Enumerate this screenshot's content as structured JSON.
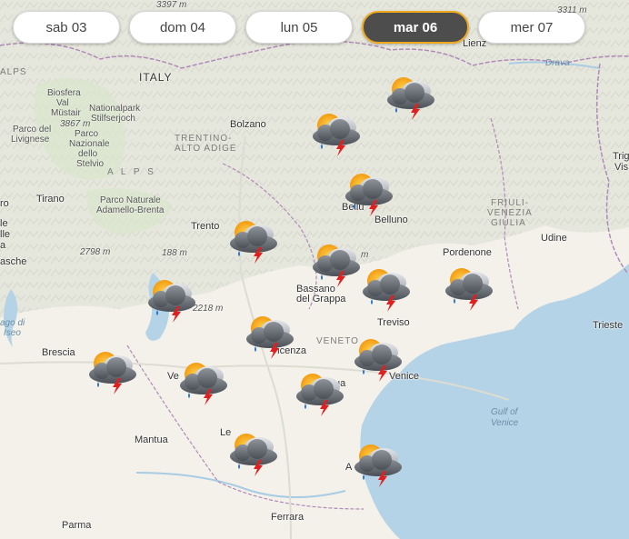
{
  "tabs": [
    {
      "label": "sab 03",
      "active": false
    },
    {
      "label": "dom 04",
      "active": false
    },
    {
      "label": "lun 05",
      "active": false
    },
    {
      "label": "mar 06",
      "active": true
    },
    {
      "label": "mer 07",
      "active": false
    }
  ],
  "labels": {
    "italy": "ITALY",
    "bolzano": "Bolzano",
    "trento": "Trento",
    "tirano": "Tirano",
    "belluno": "Belluno",
    "bassano": "Bassano",
    "del_grappa": "del Grappa",
    "pordenone": "Pordenone",
    "udine": "Udine",
    "treviso": "Treviso",
    "venice": "Venice",
    "vicenza": "Vicenza",
    "brescia": "Brescia",
    "mantua": "Mantua",
    "parma": "Parma",
    "ferrara": "Ferrara",
    "trieste": "Trieste",
    "lienz": "Lienz",
    "drava": "Drava",
    "trentino_1": "TRENTINO-",
    "trentino_2": "ALTO ADIGE",
    "veneto": "VENETO",
    "friuli_1": "FRIULI-",
    "friuli_2": "VENEZIA",
    "friuli_3": "GIULIA",
    "alps": "A L P S",
    "park_biosfera_1": "Biosfera",
    "park_biosfera_2": "Val",
    "park_biosfera_3": "Müstair",
    "park_stelvio_1": "Nationalpark",
    "park_stelvio_2": "Stilfserjoch",
    "park_stelvio_3": "Parco",
    "park_stelvio_4": "Nazionale",
    "park_stelvio_5": "dello",
    "park_stelvio_6": "Stelvio",
    "park_livigno_1": "Parco del",
    "park_livigno_2": "Livignese",
    "park_adamello_1": "Parco Naturale",
    "park_adamello_2": "Adamello-Brenta",
    "peak_3397": "3397 m",
    "peak_3311": "3311 m",
    "peak_3867": "3867 m",
    "peak_2798": "2798 m",
    "peak_188": "188 m",
    "peak_2218": "2218 m",
    "peak_m": "m",
    "alps_short": "ALPS",
    "lago_1": "ago di",
    "lago_2": "Iseo",
    "gulf_1": "Gulf of",
    "gulf_2": "Venice",
    "tri_1": "Trig",
    "tri_2": "Vis",
    "le_1": "le",
    "le_2": "lle",
    "le_3": "a",
    "le_4": "asche",
    "le_5": "ro",
    "frag_ve": "Ve",
    "frag_le": "Le",
    "frag_a": "A",
    "frag_ua": "ua",
    "frag_bellu": "Bellu"
  },
  "forecast_icon": "sun-cloud-thunderstorm-rain-icon",
  "colors": {
    "tab_active_bg": "#4d4d4d",
    "tab_active_border": "#f0a81c",
    "water": "#b5d3e7",
    "land": "#f3f1ea",
    "sun": "#f5a623",
    "cloud": "#8a8f96",
    "lightning": "#e02020",
    "rain": "#1f6fd1"
  }
}
